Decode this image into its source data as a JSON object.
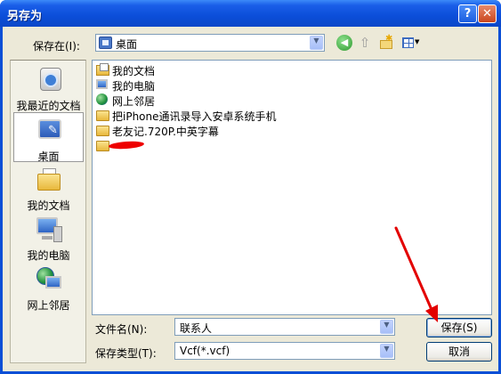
{
  "window": {
    "title": "另存为"
  },
  "titlebar": {
    "help_label": "?",
    "close_label": "✕"
  },
  "toolbar": {
    "save_in_label": "保存在(I):",
    "location": "桌面",
    "icons": [
      "back-icon",
      "up-folder-icon",
      "new-folder-icon",
      "views-menu-icon"
    ]
  },
  "places": [
    {
      "label": "我最近的文档",
      "icon": "recent-documents-icon"
    },
    {
      "label": "桌面",
      "icon": "desktop-icon",
      "selected": true
    },
    {
      "label": "我的文档",
      "icon": "my-documents-icon"
    },
    {
      "label": "我的电脑",
      "icon": "my-computer-icon"
    },
    {
      "label": "网上邻居",
      "icon": "network-places-icon"
    }
  ],
  "files": [
    {
      "name": "我的文档",
      "icon": "my-documents-icon"
    },
    {
      "name": "我的电脑",
      "icon": "my-computer-icon"
    },
    {
      "name": "网上邻居",
      "icon": "network-places-icon"
    },
    {
      "name": "把iPhone通讯录导入安卓系统手机",
      "icon": "folder-icon"
    },
    {
      "name": "老友记.720P.中英字幕",
      "icon": "folder-icon"
    },
    {
      "name": "",
      "icon": "folder-icon",
      "redacted": true
    }
  ],
  "form": {
    "filename_label": "文件名(N):",
    "filename_value": "联系人",
    "filetype_label": "保存类型(T):",
    "filetype_value": "Vcf(*.vcf)",
    "save_label": "保存(S)",
    "cancel_label": "取消"
  },
  "colors": {
    "titlebar": "#0b4ed9",
    "dialog_bg": "#ece9d8",
    "annotation_arrow": "#e30000"
  }
}
